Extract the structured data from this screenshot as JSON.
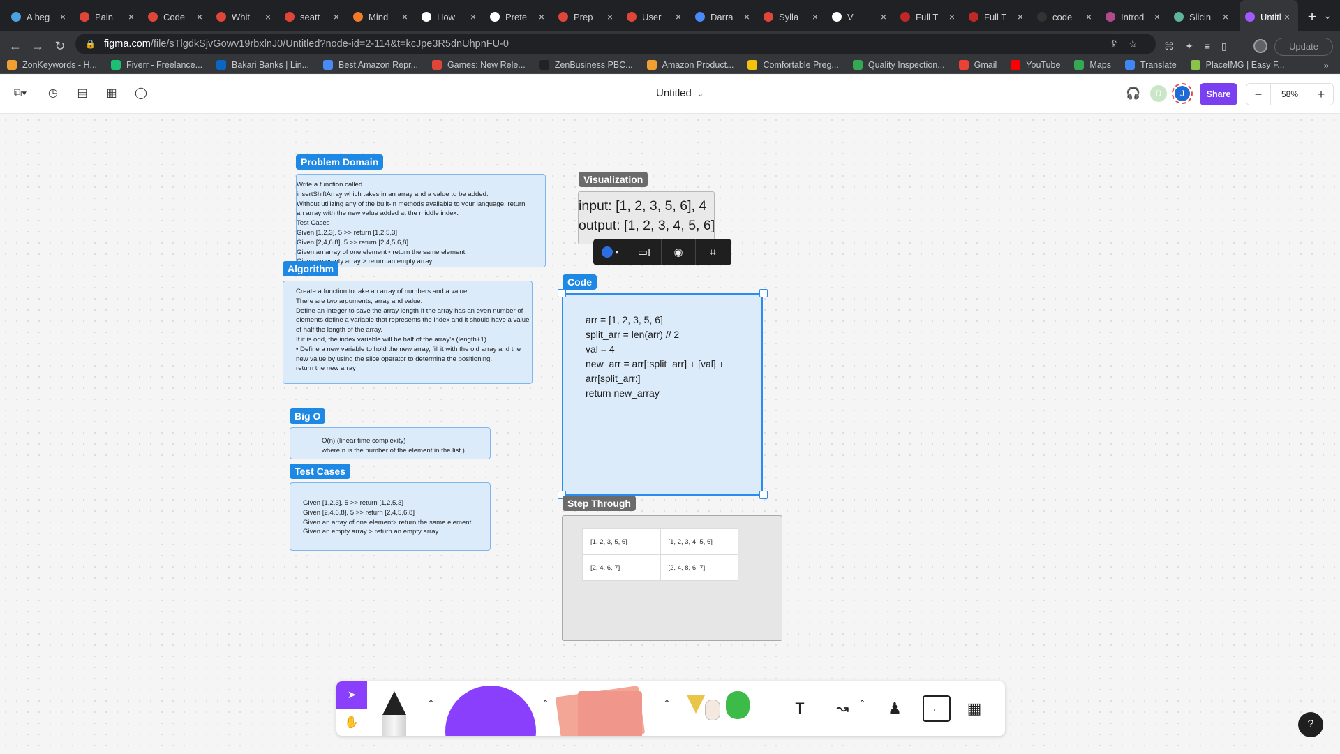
{
  "browser": {
    "tabs": [
      {
        "title": "A beg",
        "color": "#4aa3df"
      },
      {
        "title": "Pain",
        "color": "#e0453a"
      },
      {
        "title": "Code",
        "color": "#e0453a"
      },
      {
        "title": "Whit",
        "color": "#e0453a"
      },
      {
        "title": "seatt",
        "color": "#e0453a"
      },
      {
        "title": "Mind",
        "color": "#f27b2a"
      },
      {
        "title": "How",
        "color": "#ffffff"
      },
      {
        "title": "Prete",
        "color": "#ffffff"
      },
      {
        "title": "Prep",
        "color": "#e0453a"
      },
      {
        "title": "User",
        "color": "#e0453a"
      },
      {
        "title": "Darra",
        "color": "#4a8af4"
      },
      {
        "title": "Sylla",
        "color": "#e0453a"
      },
      {
        "title": "V",
        "color": "#ffffff"
      },
      {
        "title": "Full T",
        "color": "#c02828"
      },
      {
        "title": "Full T",
        "color": "#c02828"
      },
      {
        "title": "code",
        "color": "#333333"
      },
      {
        "title": "Introd",
        "color": "#b04a8a"
      },
      {
        "title": "Slicin",
        "color": "#5fb49a"
      }
    ],
    "active_tab": {
      "title": "Untitl",
      "color": "#a259ff"
    },
    "url_domain": "figma.com",
    "url_rest": "/file/sTlgdkSjvGowv19rbxlnJ0/Untitled?node-id=2-114&t=kcJpe3R5dnUhpnFU-0",
    "update_label": "Update",
    "bookmarks": [
      {
        "label": "ZonKeywords - H...",
        "color": "#f0a030"
      },
      {
        "label": "Fiverr - Freelance...",
        "color": "#1dbf73"
      },
      {
        "label": "Bakari Banks | Lin...",
        "color": "#0a66c2"
      },
      {
        "label": "Best Amazon Repr...",
        "color": "#4a8af4"
      },
      {
        "label": "Games: New Rele...",
        "color": "#e0453a"
      },
      {
        "label": "ZenBusiness PBC...",
        "color": "#222222"
      },
      {
        "label": "Amazon Product...",
        "color": "#f0a030"
      },
      {
        "label": "Comfortable Preg...",
        "color": "#f4c20d"
      },
      {
        "label": "Quality Inspection...",
        "color": "#34a853"
      },
      {
        "label": "Gmail",
        "color": "#ea4335"
      },
      {
        "label": "YouTube",
        "color": "#ff0000"
      },
      {
        "label": "Maps",
        "color": "#34a853"
      },
      {
        "label": "Translate",
        "color": "#4285f4"
      },
      {
        "label": "PlaceIMG | Easy F...",
        "color": "#8bc34a"
      }
    ],
    "bookmarks_more": "»"
  },
  "figma": {
    "doc_title": "Untitled",
    "avatar_d": "D",
    "avatar_j": "J",
    "share_label": "Share",
    "zoom_minus": "−",
    "zoom_level": "58%",
    "zoom_plus": "+",
    "accent": "#7b3ff2"
  },
  "board": {
    "problem_domain": {
      "label": "Problem Domain",
      "lines": [
        "Write a function called",
        "insertShiftArray which takes in an array and a value to be added.",
        "Without utilizing any of the built-in methods available to your language, return",
        "an array with the new value added at the middle index.",
        "Test Cases",
        "Given [1,2,3], 5 >> return [1,2,5,3]",
        "Given [2,4,6,8], 5 >> return [2,4,5,6,8]",
        "Given an array of one element> return the same element.",
        "Given an empty array > return an empty array."
      ]
    },
    "algorithm": {
      "label": "Algorithm",
      "lines": [
        "Create a function to take an array of numbers and a value.",
        "There are two arguments, array and value.",
        "Define an integer to save the array length If the array has an even number of",
        "elements define a variable that represents the index and it should have a value",
        "of half the length of the array.",
        "If it is odd, the index variable will be half of the array's (length+1).",
        "• Define a new variable to hold the new array, fill it with the old array and the",
        "new value by using the slice operator to determine the positioning.",
        "return the new array"
      ]
    },
    "big_o": {
      "label": "Big O",
      "lines": [
        "O(n) (linear time complexity)",
        "where n is the number of the element in the list.)"
      ]
    },
    "test_cases": {
      "label": "Test Cases",
      "lines": [
        "Given [1,2,3], 5 >> return [1,2,5,3]",
        "Given [2,4,6,8], 5 >> return [2,4,5,6,8]",
        "Given an array of one element> return the same element.",
        "Given an empty array > return an empty array."
      ]
    },
    "visualization": {
      "label": "Visualization",
      "lines": [
        "input: [1, 2, 3, 5, 6], 4",
        "output: [1, 2, 3, 4, 5, 6]"
      ]
    },
    "code": {
      "label": "Code",
      "lines": [
        "arr = [1, 2, 3, 5, 6]",
        "split_arr = len(arr) // 2",
        "val = 4",
        "new_arr = arr[:split_arr] + [val] +",
        "arr[split_arr:]",
        "return new_array"
      ]
    },
    "step_through": {
      "label": "Step Through",
      "rows": [
        [
          "[1, 2, 3, 5, 6]",
          "[1, 2, 3, 4, 5, 6]"
        ],
        [
          "[2, 4, 6, 7]",
          "[2, 4, 8, 6, 7]"
        ]
      ]
    },
    "accent_blue": "#1e88e5"
  },
  "bottom_toolbar": {
    "tools": [
      "select-tool",
      "hand-tool",
      "pen-tool",
      "shape-tool",
      "sticky-note-tool",
      "stickers-tool",
      "text-tool",
      "connector-tool",
      "stamp-tool",
      "section-tool",
      "table-tool"
    ],
    "text_glyph": "T",
    "help_label": "?"
  }
}
